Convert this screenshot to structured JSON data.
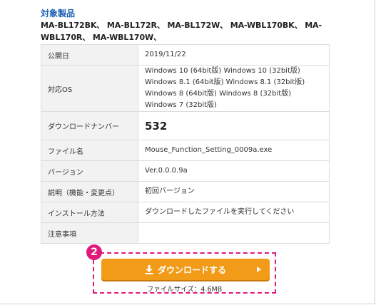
{
  "section": {
    "title": "対象製品",
    "models": "MA-BL172BK、 MA-BL172R、 MA-BL172W、 MA-WBL170BK、 MA-WBL170R、 MA-WBL170W、"
  },
  "rows": [
    {
      "key": "公開日",
      "value": "2019/11/22"
    },
    {
      "key": "対応OS",
      "value": "Windows 10 (64bit版)  Windows 10 (32bit版)  Windows 8.1 (64bit版)  Windows 8.1 (32bit版)  Windows 8 (64bit版)  Windows 8 (32bit版)  Windows 7 (32bit版)"
    },
    {
      "key": "ダウンロードナンバー",
      "value": "532"
    },
    {
      "key": "ファイル名",
      "value": "Mouse_Function_Setting_0009a.exe"
    },
    {
      "key": "バージョン",
      "value": "Ver.0.0.0.9a"
    },
    {
      "key": "説明（機能・変更点）",
      "value": "初回バージョン"
    },
    {
      "key": "インストール方法",
      "value": "ダウンロードしたファイルを実行してください"
    },
    {
      "key": "注意事項",
      "value": ""
    }
  ],
  "callout": {
    "badge": "2"
  },
  "download": {
    "label": "ダウンロードする",
    "filesize": "ファイルサイズ：4.6MB"
  },
  "colors": {
    "accent": "#f29b18",
    "highlight": "#e0197a",
    "title": "#1a5fb4"
  }
}
